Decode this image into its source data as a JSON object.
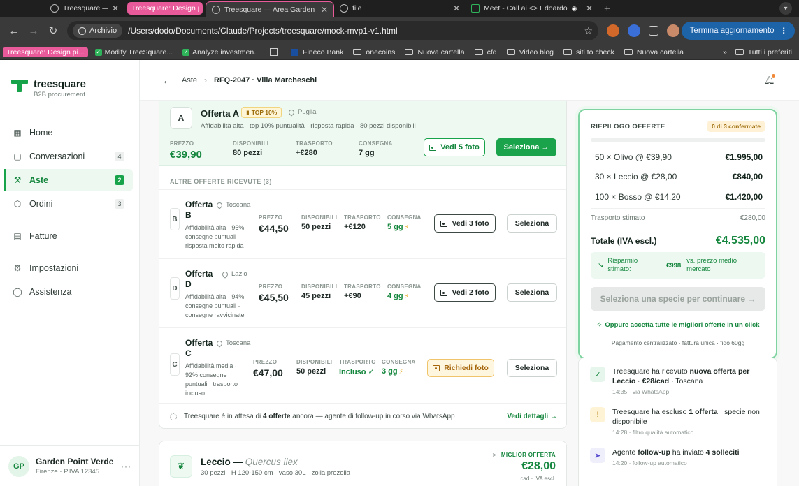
{
  "browser": {
    "tabs": [
      {
        "label": "Treesquare — Area Garden Po"
      },
      {
        "label": "Treesquare: Design p"
      },
      {
        "label": "Treesquare — Area Garden Po"
      },
      {
        "label": "file"
      },
      {
        "label": "Meet - Call ai <> Edoardo"
      }
    ],
    "archivio": "Archivio",
    "url": "/Users/dodo/Documents/Claude/Projects/treesquare/mock-mvp1-v1.html",
    "update_label": "Termina aggiornamento",
    "bookmarks": [
      "Treesquare: Design pi...",
      "Modify TreeSquare...",
      "Analyze investmen...",
      "Fineco Bank",
      "onecoins",
      "Nuova cartella",
      "cfd",
      "Video blog",
      "siti to check",
      "Nuova cartella"
    ],
    "all_bookmarks": "Tutti i preferiti"
  },
  "brand": {
    "name": "treesquare",
    "tagline": "B2B procurement"
  },
  "sidebar": {
    "items": [
      {
        "label": "Home",
        "icon": "grid-icon"
      },
      {
        "label": "Conversazioni",
        "count": "4",
        "icon": "chat-icon"
      },
      {
        "label": "Aste",
        "count": "2",
        "icon": "gavel-icon"
      },
      {
        "label": "Ordini",
        "count": "3",
        "icon": "box-icon"
      },
      {
        "label": "Fatture",
        "icon": "invoice-icon"
      },
      {
        "label": "Impostazioni",
        "icon": "gear-icon"
      },
      {
        "label": "Assistenza",
        "icon": "help-icon"
      }
    ],
    "user": {
      "initials": "GP",
      "name": "Garden Point Verde",
      "sub": "Firenze · P.IVA 12345"
    }
  },
  "breadcrumb": {
    "parent": "Aste",
    "current": "RFQ-2047 · Villa Marcheschi"
  },
  "best_offer": {
    "letter": "A",
    "title": "Offerta A",
    "badge": "TOP 10%",
    "region": "Puglia",
    "desc": "Affidabilità alta · top 10% puntualità · risposta rapida · 80 pezzi disponibili",
    "price_label": "PREZZO",
    "price": "€39,90",
    "avail_label": "DISPONIBILI",
    "avail": "80 pezzi",
    "ship_label": "TRASPORTO",
    "ship": "+€280",
    "delivery_label": "CONSEGNA",
    "delivery": "7 gg",
    "photos_label": "Vedi 5 foto",
    "select_label": "Seleziona →"
  },
  "other_offers_label": "ALTRE OFFERTE RICEVUTE (3)",
  "offers": [
    {
      "letter": "B",
      "title": "Offerta B",
      "region": "Toscana",
      "desc": "Affidabilità alta · 96% consegne puntuali · risposta molto rapida",
      "price_label": "PREZZO",
      "price": "€44,50",
      "avail_label": "DISPONIBILI",
      "avail": "50 pezzi",
      "ship_label": "TRASPORTO",
      "ship": "+€120",
      "delivery_label": "CONSEGNA",
      "delivery": "5 gg",
      "photo_btn": "Vedi 3 foto",
      "select_label": "Seleziona"
    },
    {
      "letter": "D",
      "title": "Offerta D",
      "region": "Lazio",
      "desc": "Affidabilità alta · 94% consegne puntuali · consegne ravvicinate",
      "price_label": "PREZZO",
      "price": "€45,50",
      "avail_label": "DISPONIBILI",
      "avail": "45 pezzi",
      "ship_label": "TRASPORTO",
      "ship": "+€90",
      "delivery_label": "CONSEGNA",
      "delivery": "4 gg",
      "photo_btn": "Vedi 2 foto",
      "select_label": "Seleziona"
    },
    {
      "letter": "C",
      "title": "Offerta C",
      "region": "Toscana",
      "desc": "Affidabilità media · 92% consegne puntuali · trasporto incluso",
      "price_label": "PREZZO",
      "price": "€47,00",
      "avail_label": "DISPONIBILI",
      "avail": "50 pezzi",
      "ship_label": "TRASPORTO",
      "ship": "Incluso ✓",
      "delivery_label": "CONSEGNA",
      "delivery": "3 gg",
      "photo_btn": "Richiedi foto",
      "select_label": "Seleziona"
    }
  ],
  "followup": {
    "pre": "Treesquare è in attesa di ",
    "bold": "4 offerte",
    "post": " ancora — agente di follow-up in corso via WhatsApp",
    "link": "Vedi dettagli →"
  },
  "species": {
    "name": "Leccio — ",
    "latin": "Quercus ilex",
    "spec": "30 pezzi · H 120-150 cm · vaso 30L · zolla prezolla",
    "best_label": "MIGLIOR OFFERTA",
    "best_value": "€28,00",
    "best_sub": "cad · IVA escl."
  },
  "summary": {
    "title": "RIEPILOGO OFFERTE",
    "badge": "0 di 3 confermate",
    "progress": 0,
    "lines": [
      {
        "label": "50 × Olivo @ €39,90",
        "amount": "€1.995,00"
      },
      {
        "label": "30 × Leccio @ €28,00",
        "amount": "€840,00"
      },
      {
        "label": "100 × Bosso @ €14,20",
        "amount": "€1.420,00"
      }
    ],
    "shipping_label": "Trasporto stimato",
    "shipping": "€280,00",
    "total_label": "Totale (IVA escl.)",
    "total": "€4.535,00",
    "saving_label": "Risparmio stimato:",
    "saving_value": "€998",
    "saving_note": "vs. prezzo medio mercato",
    "cta": "Seleziona una specie per continuare →",
    "accept_all": "Oppure accetta tutte le migliori offerte in un click",
    "pay_note": "Pagamento centralizzato · fattura unica · fido 60gg"
  },
  "activity": [
    {
      "pre": "Treesquare ha ricevuto ",
      "bold": "nuova offerta per Leccio · €28/cad",
      "post": " · Toscana",
      "meta": "14:35 · via WhatsApp"
    },
    {
      "pre": "Treesquare ha escluso ",
      "bold": "1 offerta",
      "post": " · specie non disponibile",
      "meta": "14:28 · filtro qualità automatico"
    },
    {
      "pre": "Agente ",
      "bold": "follow-up",
      "post": " ha inviato 4 solleciti",
      "mid": "ha inviato ",
      "bold2": "4 solleciti",
      "meta": "14:20 · follow-up automatico"
    }
  ]
}
